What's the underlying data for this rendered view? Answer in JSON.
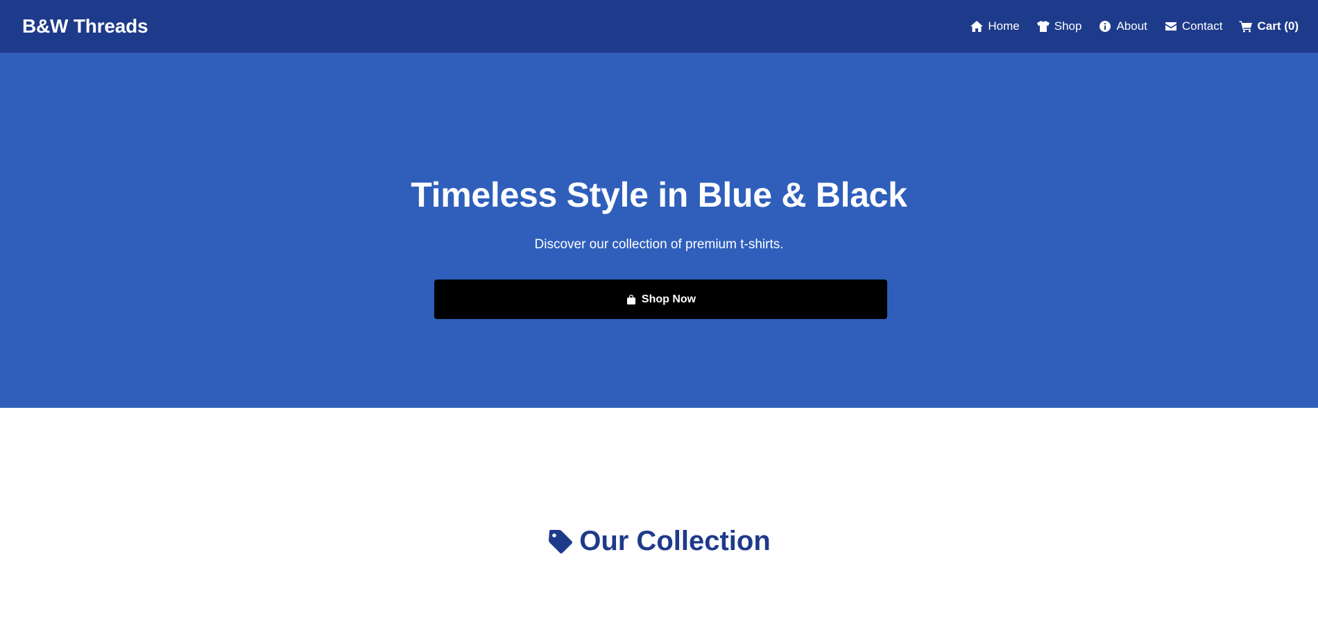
{
  "header": {
    "brand": "B&W Threads",
    "nav": [
      {
        "label": "Home",
        "icon": "home-icon"
      },
      {
        "label": "Shop",
        "icon": "tshirt-icon"
      },
      {
        "label": "About",
        "icon": "info-icon"
      },
      {
        "label": "Contact",
        "icon": "envelope-icon"
      },
      {
        "label": "Cart (0)",
        "icon": "cart-icon"
      }
    ]
  },
  "hero": {
    "title": "Timeless Style in Blue & Black",
    "subtitle": "Discover our collection of premium t-shirts.",
    "cta_label": "Shop Now",
    "cta_icon": "shopping-bag-icon"
  },
  "collection": {
    "heading": "Our Collection",
    "icon": "tag-icon"
  },
  "colors": {
    "header_bg": "#1e3a8a",
    "hero_bg": "#2f5fbb",
    "button_bg": "#000000",
    "heading_color": "#1e3a8a"
  }
}
